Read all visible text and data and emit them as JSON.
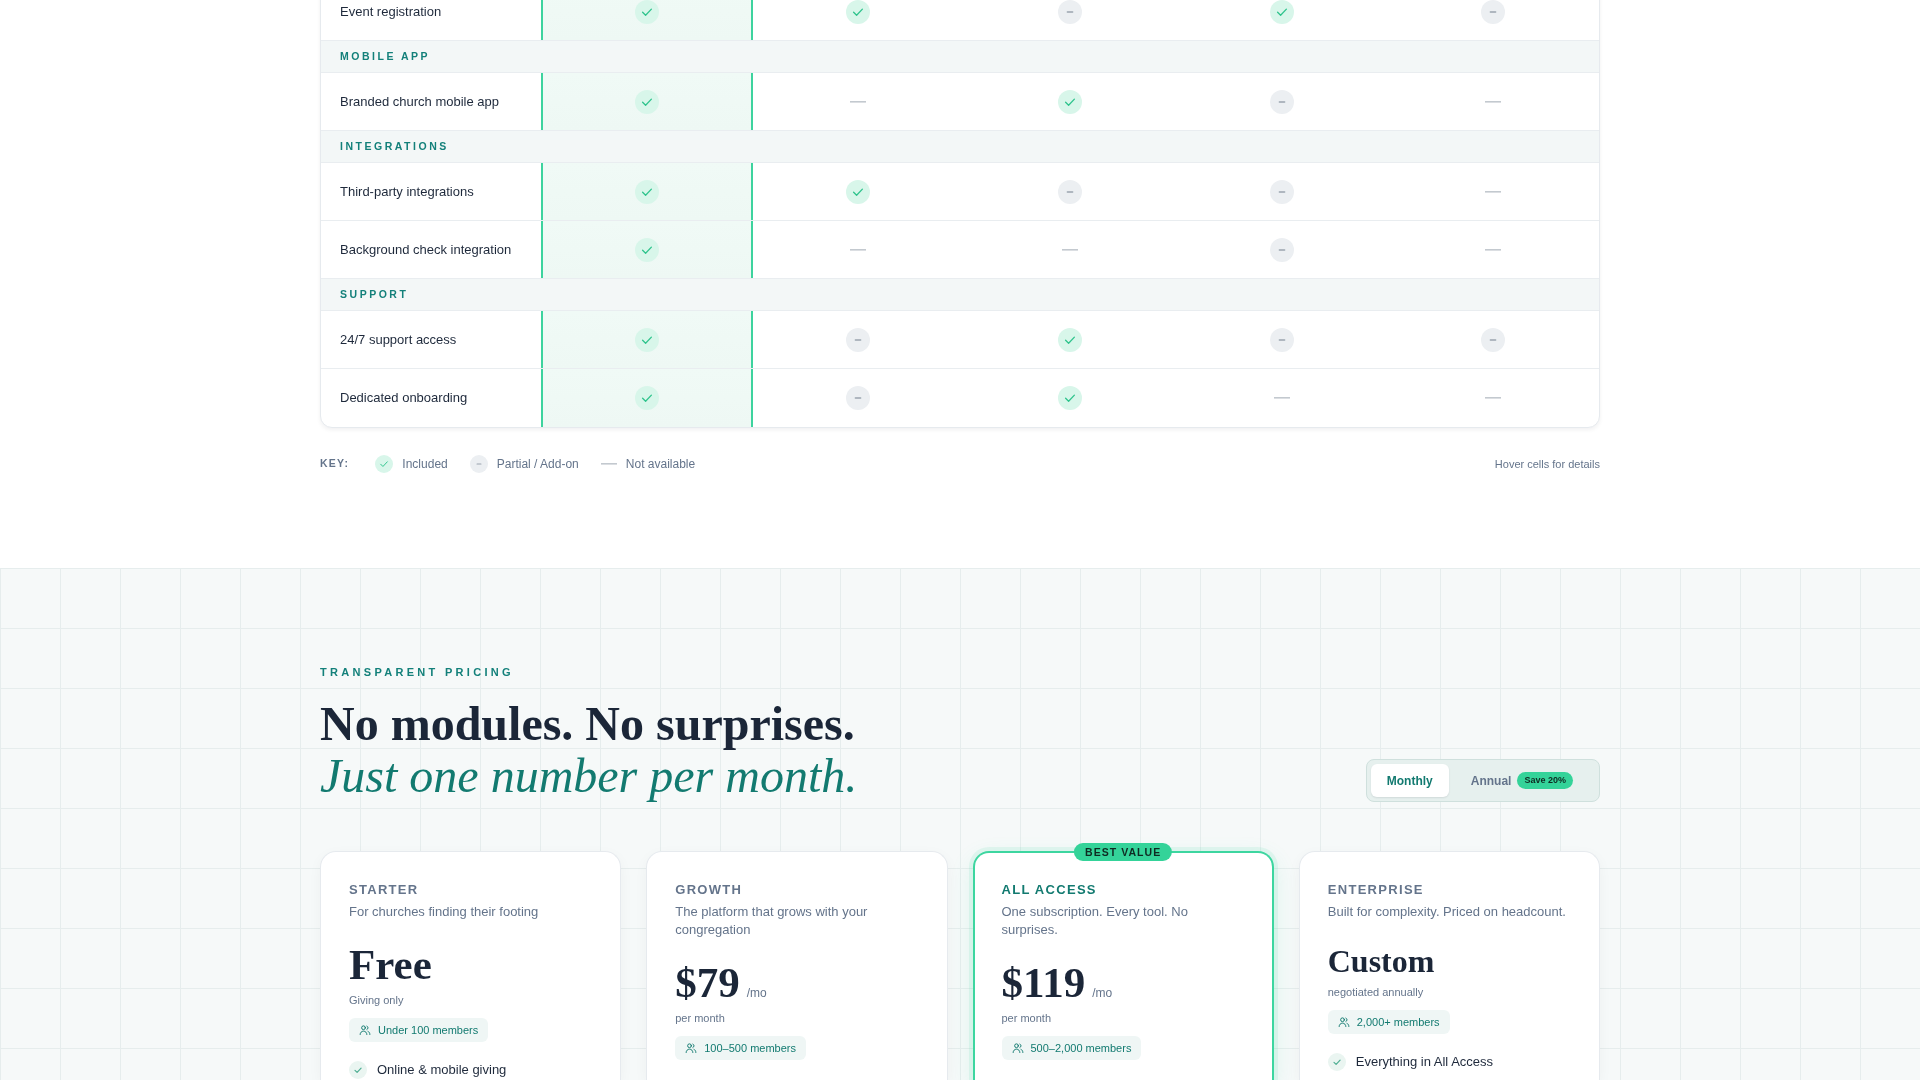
{
  "comparison": {
    "columns": [
      {
        "highlighted": true
      },
      {
        "highlighted": false
      },
      {
        "highlighted": false
      },
      {
        "highlighted": false
      },
      {
        "highlighted": false
      }
    ],
    "rows": [
      {
        "kind": "feature",
        "label": "Event registration",
        "cells": [
          {
            "kind": "included"
          },
          {
            "kind": "included"
          },
          {
            "kind": "partial"
          },
          {
            "kind": "included"
          },
          {
            "kind": "partial"
          }
        ]
      },
      {
        "kind": "section",
        "label": "MOBILE APP"
      },
      {
        "kind": "feature",
        "label": "Branded church mobile app",
        "cells": [
          {
            "kind": "included"
          },
          {
            "kind": "none"
          },
          {
            "kind": "included"
          },
          {
            "kind": "partial"
          },
          {
            "kind": "none"
          }
        ]
      },
      {
        "kind": "section",
        "label": "INTEGRATIONS"
      },
      {
        "kind": "feature",
        "label": "Third-party integrations",
        "cells": [
          {
            "kind": "included"
          },
          {
            "kind": "included"
          },
          {
            "kind": "partial"
          },
          {
            "kind": "partial"
          },
          {
            "kind": "none"
          }
        ]
      },
      {
        "kind": "feature",
        "label": "Background check integration",
        "cells": [
          {
            "kind": "included"
          },
          {
            "kind": "none"
          },
          {
            "kind": "none"
          },
          {
            "kind": "partial"
          },
          {
            "kind": "none"
          }
        ]
      },
      {
        "kind": "section",
        "label": "SUPPORT"
      },
      {
        "kind": "feature",
        "label": "24/7 support access",
        "cells": [
          {
            "kind": "included"
          },
          {
            "kind": "partial"
          },
          {
            "kind": "included"
          },
          {
            "kind": "partial"
          },
          {
            "kind": "partial"
          }
        ]
      },
      {
        "kind": "feature",
        "label": "Dedicated onboarding",
        "cells": [
          {
            "kind": "included"
          },
          {
            "kind": "partial"
          },
          {
            "kind": "included"
          },
          {
            "kind": "none"
          },
          {
            "kind": "none"
          }
        ]
      }
    ]
  },
  "key": {
    "title": "KEY:",
    "items": [
      {
        "kind": "included",
        "label": "Included"
      },
      {
        "kind": "partial",
        "label": "Partial / Add-on"
      },
      {
        "kind": "none",
        "label": "Not available"
      }
    ],
    "hint": "Hover cells for details"
  },
  "pricing": {
    "eyebrow": "TRANSPARENT PRICING",
    "headline": "No modules. No surprises.",
    "headline_accent": "Just one number per month.",
    "billing_toggle": [
      {
        "label": "Monthly",
        "selected": true
      },
      {
        "label": "Annual",
        "selected": false,
        "badge": "Save 20%"
      }
    ],
    "plans": [
      {
        "name": "STARTER",
        "featured": false,
        "description": "For churches finding their footing",
        "price": {
          "kind": "free",
          "value": "Free"
        },
        "price_note": "Giving only",
        "members": "Under 100 members",
        "features": [
          "Online & mobile giving"
        ]
      },
      {
        "name": "GROWTH",
        "featured": false,
        "description": "The platform that grows with your congregation",
        "price": {
          "kind": "amount",
          "value": "$79",
          "unit": "/mo"
        },
        "price_note": "per month",
        "members": "100–500 members"
      },
      {
        "name": "ALL ACCESS",
        "featured": true,
        "badge": "BEST VALUE",
        "description": "One subscription. Every tool. No surprises.",
        "price": {
          "kind": "amount",
          "value": "$119",
          "unit": "/mo"
        },
        "price_note": "per month",
        "members": "500–2,000 members"
      },
      {
        "name": "ENTERPRISE",
        "featured": false,
        "description": "Built for complexity. Priced on headcount.",
        "price": {
          "kind": "custom",
          "value": "Custom"
        },
        "price_note": "negotiated annually",
        "members": "2,000+ members",
        "features": [
          "Everything in All Access"
        ]
      }
    ]
  }
}
